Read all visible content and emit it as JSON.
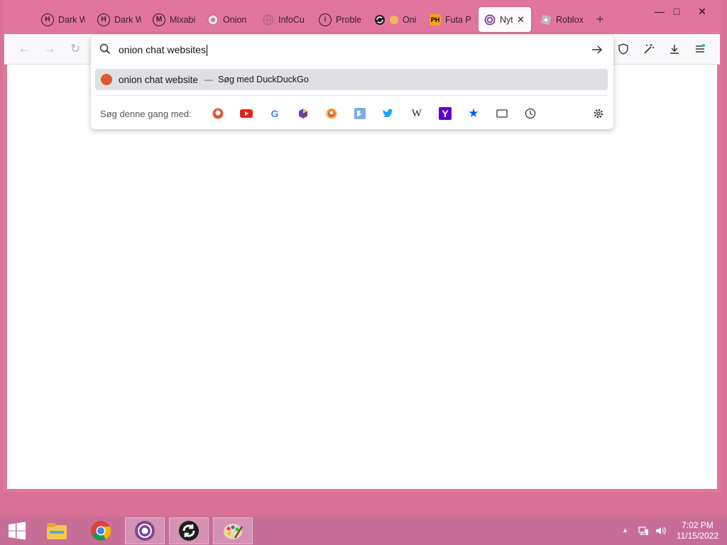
{
  "window": {
    "minimize": "—",
    "maximize": "□",
    "close": "✕"
  },
  "tabs": [
    {
      "label": "Dark W",
      "icon": "H"
    },
    {
      "label": "Dark W",
      "icon": "H"
    },
    {
      "label": "Mixabi",
      "icon": "M"
    },
    {
      "label": "Onion",
      "icon": "onion"
    },
    {
      "label": "InfoCu",
      "icon": "globe"
    },
    {
      "label": "Proble",
      "icon": "i"
    },
    {
      "label": "Oni",
      "icon": "sync"
    },
    {
      "label": "Futa P",
      "icon": "PH"
    },
    {
      "label": "Nyt",
      "icon": "tor",
      "close": "✕"
    },
    {
      "label": "Roblox",
      "icon": "roblox"
    }
  ],
  "new_tab": "+",
  "urlbar": {
    "value": "onion chat websites"
  },
  "suggestion": {
    "query": "onion chat website",
    "separator": "—",
    "action": "Søg med DuckDuckGo"
  },
  "search_with": {
    "label": "Søg denne gang med:"
  },
  "engines": [
    "duckduckgo",
    "youtube",
    "google",
    "startpage",
    "duckduckgo-onion",
    "bing",
    "twitter",
    "wikipedia",
    "yahoo",
    "bookmarks",
    "tabs",
    "history"
  ],
  "taskbar": {
    "time": "7:02 PM",
    "date": "11/15/2022"
  },
  "colors": {
    "frame": "#e1759d",
    "taskbar": "#c76e98",
    "active_tab": "#fdfbfc"
  }
}
